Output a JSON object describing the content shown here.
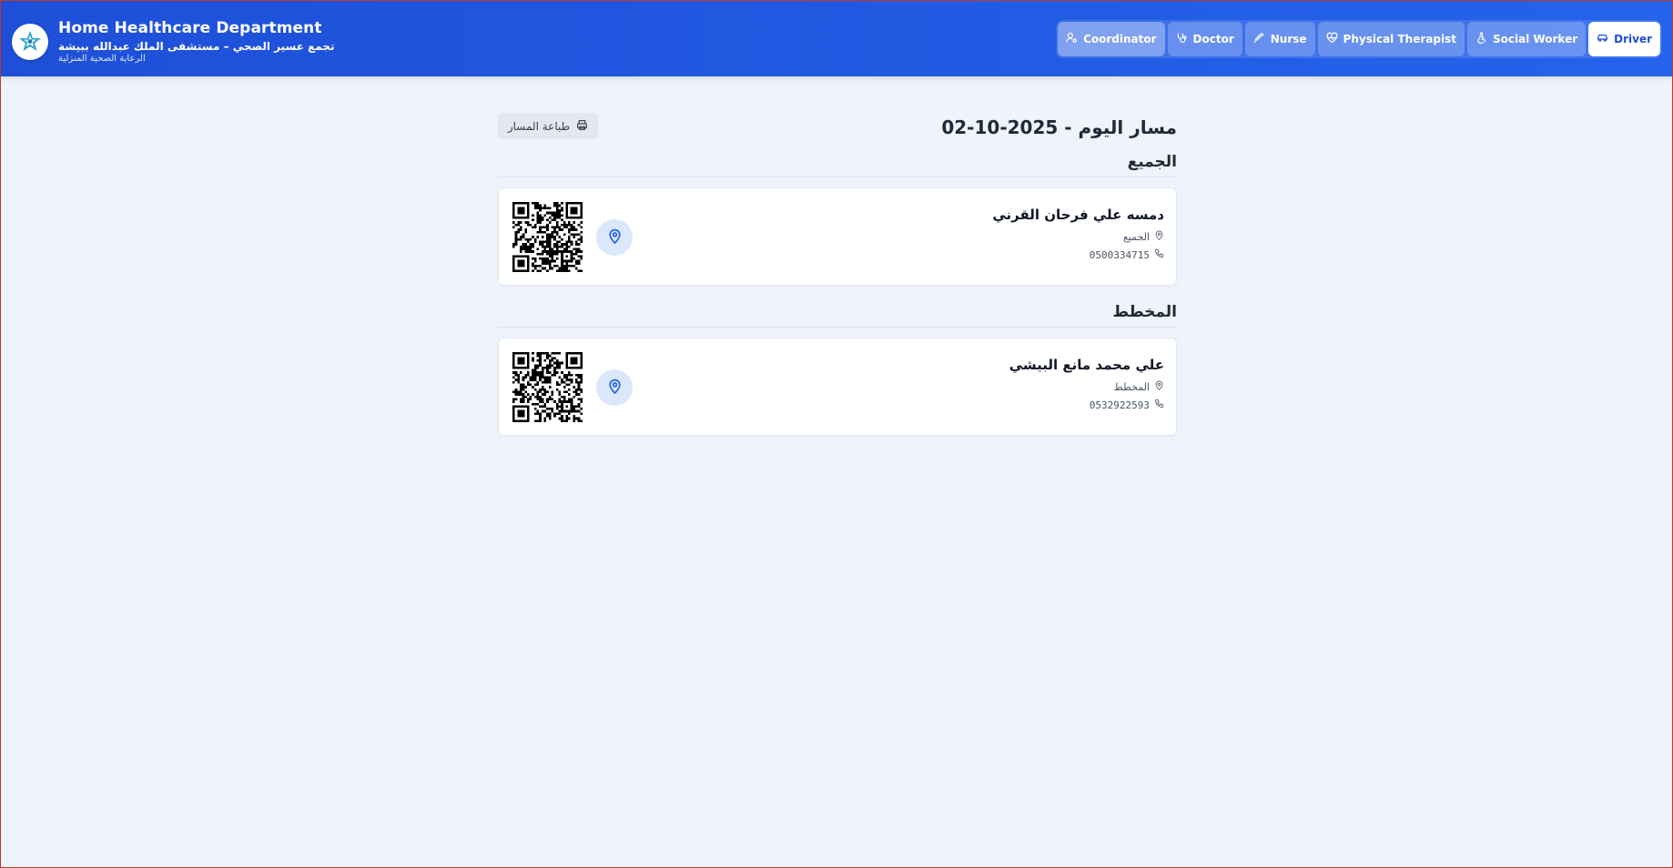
{
  "header": {
    "title": "Home Healthcare Department",
    "subtitle": "تجمع عسير الصحي – مستشفى الملك عبدالله ببيشة",
    "subtitle2": "الرعاية الصحية المنزلية",
    "logo_icon": "star-logo-icon"
  },
  "nav": {
    "items": [
      {
        "label": "Coordinator",
        "icon": "user-cog-icon"
      },
      {
        "label": "Doctor",
        "icon": "stethoscope-icon"
      },
      {
        "label": "Nurse",
        "icon": "syringe-icon"
      },
      {
        "label": "Physical Therapist",
        "icon": "heart-pulse-icon"
      },
      {
        "label": "Social Worker",
        "icon": "accessibility-icon"
      },
      {
        "label": "Driver",
        "icon": "car-icon"
      }
    ],
    "active": "Driver"
  },
  "main": {
    "title": "مسار اليوم - 2025-10-02",
    "print_label": "طباعة المسار",
    "sections": [
      {
        "title": "الجميع",
        "cards": [
          {
            "name": "دمسه علي فرحان القرني",
            "location": "الجميع",
            "phone": "0500334715"
          }
        ]
      },
      {
        "title": "المخطط",
        "cards": [
          {
            "name": "علي محمد مانع البيشي",
            "location": "المخطط",
            "phone": "0532922593"
          }
        ]
      }
    ]
  },
  "colors": {
    "header_bg": "#2563eb",
    "page_bg": "#eef3fc",
    "accent": "#1d4ed8",
    "pin_bg": "#dbe7fb"
  }
}
